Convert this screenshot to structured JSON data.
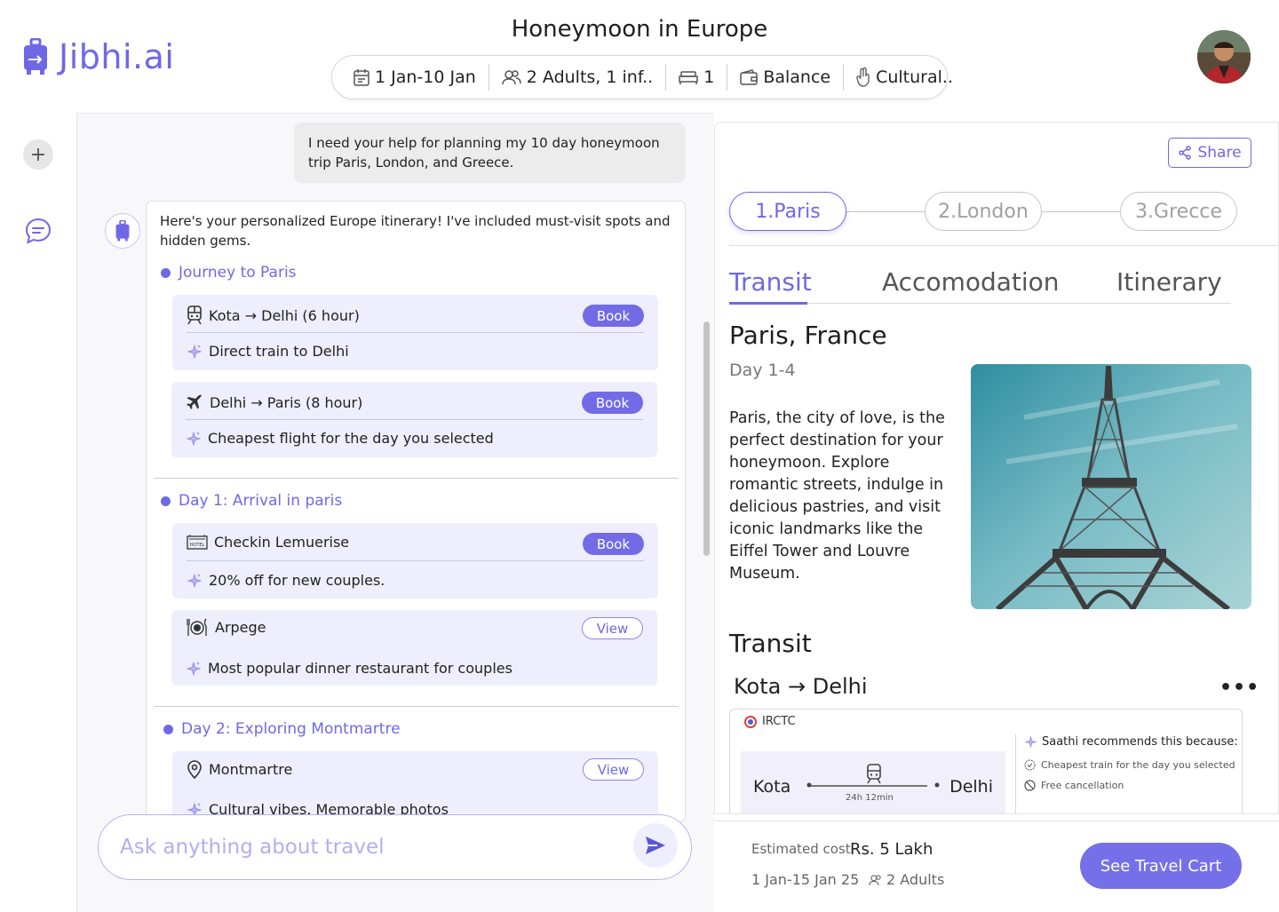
{
  "brand": {
    "name": "Jibhi.ai",
    "logo_icon": "suitcase-icon",
    "color": "#6f68e6"
  },
  "trip": {
    "title": "Honeymoon in Europe",
    "filters": [
      {
        "icon": "calendar-icon",
        "label": "1 Jan-10 Jan"
      },
      {
        "icon": "people-icon",
        "label": "2 Adults, 1 inf.."
      },
      {
        "icon": "bed-icon",
        "label": "1"
      },
      {
        "icon": "wallet-icon",
        "label": "Balance"
      },
      {
        "icon": "hand-icon",
        "label": "Cultural.."
      }
    ]
  },
  "chat": {
    "user_message": "I need your help for planning my  10 day honeymoon trip Paris, London, and Greece.",
    "bot_intro": "Here's your personalized Europe itinerary! I've included must-visit spots and hidden gems.",
    "sections": [
      {
        "title": "Journey to Paris",
        "items": [
          {
            "icon": "train-icon",
            "title": "Kota → Delhi (6 hour)",
            "action": "Book",
            "note": "Direct train to Delhi"
          },
          {
            "icon": "plane-icon",
            "title": "Delhi → Paris (8 hour)",
            "action": "Book",
            "note": "Cheapest flight for the day you selected"
          }
        ]
      },
      {
        "title": "Day 1: Arrival in paris",
        "items": [
          {
            "icon": "hotel-icon",
            "title": "Checkin Lemuerise",
            "action": "Book",
            "note": "20% off for new couples."
          },
          {
            "icon": "dining-icon",
            "title": "Arpege",
            "action": "View",
            "note": "Most popular dinner restaurant for couples"
          }
        ]
      },
      {
        "title": "Day 2: Exploring Montmartre",
        "items": [
          {
            "icon": "location-pin-icon",
            "title": "Montmartre",
            "action": "View",
            "note": "Cultural vibes. Memorable photos"
          }
        ]
      }
    ],
    "input_placeholder": "Ask anything about travel"
  },
  "panel": {
    "share_label": "Share",
    "cities": [
      "1.Paris",
      "2.London",
      "3.Grecce"
    ],
    "tabs": [
      "Transit",
      "Accomodation",
      "Itinerary"
    ],
    "place": "Paris, France",
    "days": "Day 1-4",
    "description": "Paris, the city of love, is the perfect destination for your honeymoon. Explore romantic streets, indulge in delicious pastries, and visit iconic landmarks like the Eiffel Tower and Louvre Museum.",
    "transit_heading": "Transit",
    "route": "Kota → Delhi",
    "more": "•••",
    "provider": "IRCTC",
    "from": "Kota",
    "to": "Delhi",
    "duration": "24h 12min",
    "recommend_title": "Saathi recommends this because:",
    "reasons": [
      "Cheapest train for the day you selected",
      "Free cancellation"
    ]
  },
  "footer": {
    "estimated_label": "Estimated cost",
    "estimated_value": "Rs. 5 Lakh",
    "dates": "1 Jan-15 Jan 25",
    "pax": "2 Adults",
    "cart_button": "See Travel Cart"
  }
}
